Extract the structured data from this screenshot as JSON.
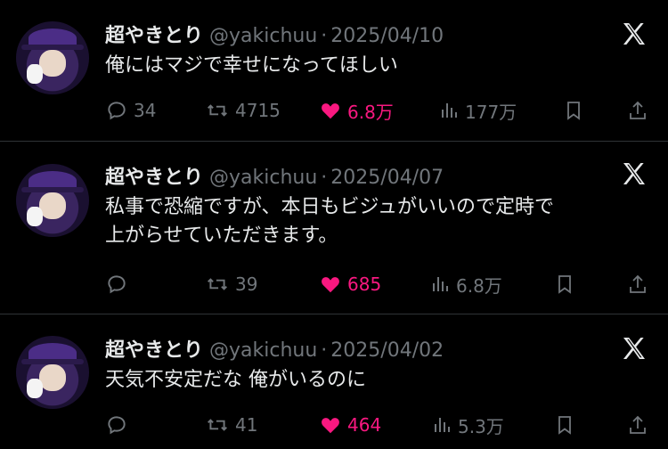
{
  "tweets": [
    {
      "name": "超やきとり",
      "handle": "@yakichuu",
      "sep": "·",
      "date": "2025/04/10",
      "text_lines": [
        "俺にはマジで幸せになってほしい"
      ],
      "replies": "34",
      "retweets": "4715",
      "likes": "6.8万",
      "views": "177万"
    },
    {
      "name": "超やきとり",
      "handle": "@yakichuu",
      "sep": "·",
      "date": "2025/04/07",
      "text_lines": [
        "私事で恐縮ですが、本日もビジュがいいので定時で",
        "上がらせていただきます。"
      ],
      "replies": "",
      "retweets": "39",
      "likes": "685",
      "views": "6.8万"
    },
    {
      "name": "超やきとり",
      "handle": "@yakichuu",
      "sep": "·",
      "date": "2025/04/02",
      "text_lines": [
        "天気不安定だな 俺がいるのに"
      ],
      "replies": "",
      "retweets": "41",
      "likes": "464",
      "views": "5.3万"
    }
  ],
  "icons": {
    "reply": "reply-icon",
    "retweet": "retweet-icon",
    "like": "heart-icon",
    "views": "views-icon",
    "bookmark": "bookmark-icon",
    "share": "share-icon",
    "brand": "x-logo-icon"
  },
  "colors": {
    "background": "#000000",
    "text": "#e7e9ea",
    "muted": "#71767b",
    "like": "#f91880",
    "divider": "#2f3336"
  }
}
